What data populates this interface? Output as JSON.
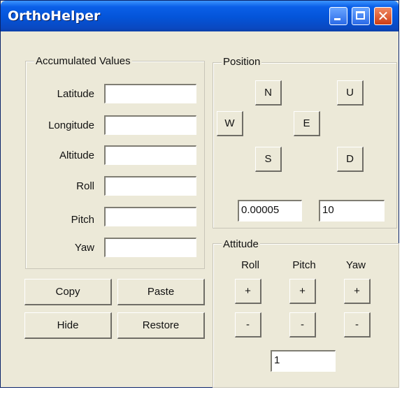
{
  "window": {
    "title": "OrthoHelper"
  },
  "accumulated": {
    "legend": "Accumulated Values",
    "fields": [
      {
        "label": "Latitude",
        "value": ""
      },
      {
        "label": "Longitude",
        "value": ""
      },
      {
        "label": "Altitude",
        "value": ""
      },
      {
        "label": "Roll",
        "value": ""
      },
      {
        "label": "Pitch",
        "value": ""
      },
      {
        "label": "Yaw",
        "value": ""
      }
    ]
  },
  "actions": {
    "copy": "Copy",
    "paste": "Paste",
    "hide": "Hide",
    "restore": "Restore"
  },
  "position": {
    "legend": "Position",
    "buttons": {
      "n": "N",
      "w": "W",
      "e": "E",
      "s": "S",
      "u": "U",
      "d": "D"
    },
    "horizontal_step": "0.00005",
    "vertical_step": "10"
  },
  "attitude": {
    "legend": "Attitude",
    "columns": [
      "Roll",
      "Pitch",
      "Yaw"
    ],
    "plus": "+",
    "minus": "-",
    "step": "1"
  },
  "icons": {
    "minimize": "minimize-icon",
    "maximize": "maximize-icon",
    "close": "close-icon"
  }
}
